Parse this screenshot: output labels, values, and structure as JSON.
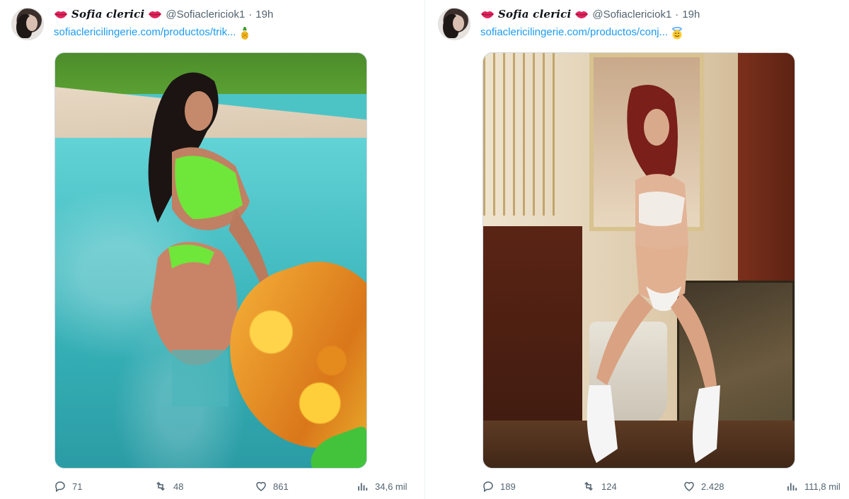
{
  "tweets": [
    {
      "display_name": "Sofia clerici",
      "handle": "@Sofiaclericiok1",
      "separator": "·",
      "time": "19h",
      "link_text": "sofiaclericilingerie.com/productos/trik...",
      "link_emoji": "pineapple-emoji",
      "actions": {
        "replies": "71",
        "reposts": "48",
        "likes": "861",
        "views": "34,6 mil"
      }
    },
    {
      "display_name": "Sofia clerici",
      "handle": "@Sofiaclericiok1",
      "separator": "·",
      "time": "19h",
      "link_text": "sofiaclericilingerie.com/productos/conj...",
      "link_emoji": "halo-smile-emoji",
      "actions": {
        "replies": "189",
        "reposts": "124",
        "likes": "2.428",
        "views": "111,8 mil"
      }
    }
  ],
  "colors": {
    "link": "#1d9bf0",
    "secondary_text": "#536471",
    "lips": "#e0245e"
  }
}
